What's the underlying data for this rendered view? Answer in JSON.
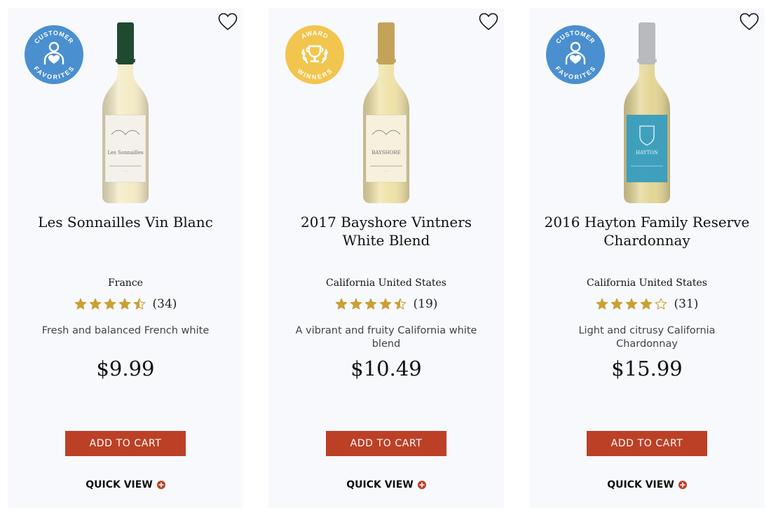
{
  "colors": {
    "card_bg": "#f8f9fd",
    "button_bg": "#bc4026",
    "star": "#c9a133",
    "customer_badge": "#4a8fcf",
    "award_badge": "#f2c54e"
  },
  "products": [
    {
      "name": "Les Sonnailles Vin Blanc",
      "region": "France",
      "rating": 4.5,
      "review_count": "(34)",
      "description": "Fresh and balanced French white",
      "price": "$9.99",
      "badge": {
        "type": "customer",
        "top": "CUSTOMER",
        "bottom": "FAVORITES"
      },
      "bottle": {
        "capsule": "#1f4a30",
        "wine": "#f4ebc6",
        "label": "#f4f1ea",
        "label_text": "Les Sonnailles"
      },
      "add_to_cart": "ADD TO CART",
      "quick_view": "QUICK VIEW"
    },
    {
      "name": "2017 Bayshore Vintners White Blend",
      "region": "California United States",
      "rating": 4.5,
      "review_count": "(19)",
      "description": "A vibrant and fruity California white blend",
      "price": "$10.49",
      "badge": {
        "type": "award",
        "top": "AWARD",
        "bottom": "WINNERS"
      },
      "bottle": {
        "capsule": "#c4a25a",
        "wine": "#efe2a8",
        "label": "#f7f0dd",
        "label_text": "BAYSHORE"
      },
      "add_to_cart": "ADD TO CART",
      "quick_view": "QUICK VIEW"
    },
    {
      "name": "2016 Hayton Family Reserve Chardonnay",
      "region": "California United States",
      "rating": 4,
      "review_count": "(31)",
      "description": "Light and citrusy California Chardonnay",
      "price": "$15.99",
      "badge": {
        "type": "customer",
        "top": "CUSTOMER",
        "bottom": "FAVORITES"
      },
      "bottle": {
        "capsule": "#b9babd",
        "wine": "#e3d696",
        "label": "#3fa0bd",
        "label_text": "HAYTON"
      },
      "add_to_cart": "ADD TO CART",
      "quick_view": "QUICK VIEW"
    }
  ]
}
